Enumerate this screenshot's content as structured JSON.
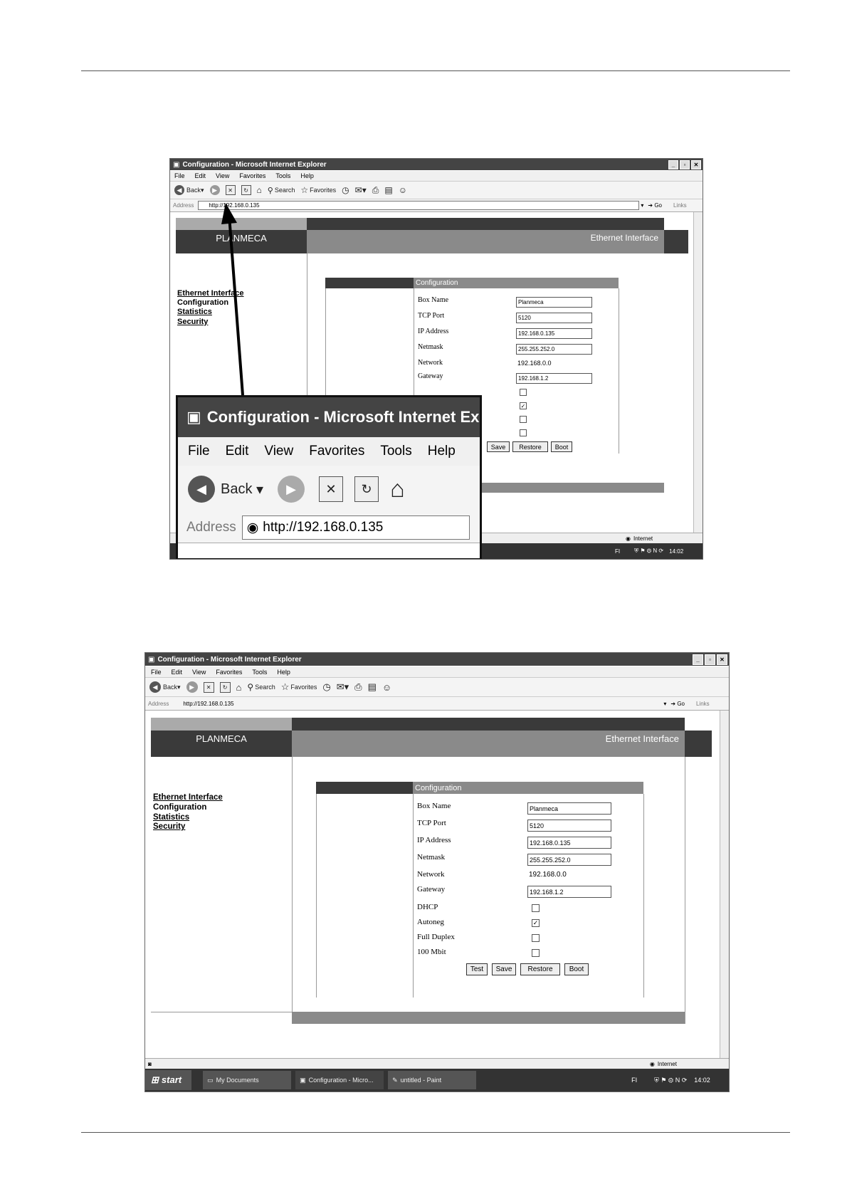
{
  "window": {
    "title": "Configuration - Microsoft Internet Explorer",
    "menu": [
      "File",
      "Edit",
      "View",
      "Favorites",
      "Tools",
      "Help"
    ],
    "toolbar": {
      "back": "Back",
      "search": "Search",
      "favorites": "Favorites"
    },
    "address_label": "Address",
    "address_value": "http://192.168.0.135",
    "go": "Go",
    "links": "Links"
  },
  "page": {
    "brand": "PLANMECA",
    "heading": "Ethernet Interface",
    "nav": [
      "Ethernet Interface",
      "Configuration",
      "Statistics",
      "Security"
    ],
    "config_title": "Configuration",
    "fields": [
      {
        "label": "Box Name",
        "value": "Planmeca"
      },
      {
        "label": "TCP Port",
        "value": "5120"
      },
      {
        "label": "IP Address",
        "value": "192.168.0.135"
      },
      {
        "label": "Netmask",
        "value": "255.255.252.0"
      },
      {
        "label": "Network",
        "value": "192.168.0.0"
      },
      {
        "label": "Gateway",
        "value": "192.168.1.2"
      }
    ],
    "checkboxes": [
      {
        "label": "DHCP",
        "checked": false
      },
      {
        "label": "Autoneg",
        "checked": true
      },
      {
        "label": "Full Duplex",
        "checked": false
      },
      {
        "label": "100 Mbit",
        "checked": false
      }
    ],
    "buttons": [
      "Test",
      "Save",
      "Restore",
      "Boot"
    ]
  },
  "status": {
    "zone": "Internet"
  },
  "taskbar": {
    "start": "start",
    "tasks": [
      "My Documents",
      "Configuration - Micro...",
      "untitled - Paint"
    ],
    "lang": "FI",
    "clock": "14:02"
  }
}
